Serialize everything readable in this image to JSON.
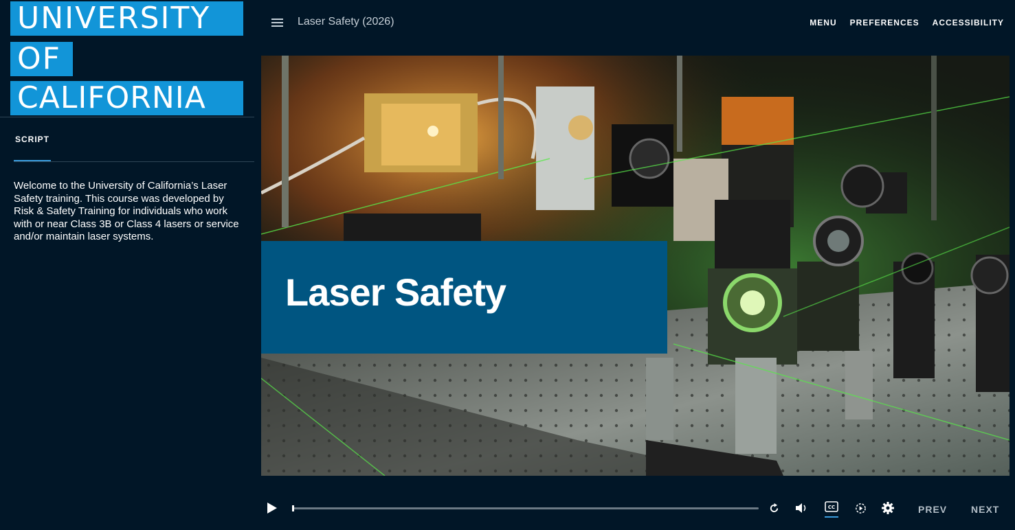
{
  "logo": {
    "lines": [
      "UNIVERSITY",
      "OF",
      "CALIFORNIA"
    ],
    "color": "#1295d8"
  },
  "sidebar": {
    "tab_label": "SCRIPT",
    "script_text": "Welcome to the University of California’s Laser Safety training. This course was developed by Risk & Safety Training for individuals who work with or near Class 3B or Class 4 lasers or service and/or maintain laser systems."
  },
  "topbar": {
    "course_title": "Laser Safety (2026)",
    "nav": [
      "MENU",
      "PREFERENCES",
      "ACCESSIBILITY"
    ]
  },
  "slide": {
    "title": "Laser Safety",
    "banner_color": "#005581"
  },
  "player": {
    "progress_fraction": 0.0,
    "icons": [
      "play-icon",
      "replay-icon",
      "volume-icon",
      "closed-captions-icon",
      "playback-speed-icon",
      "settings-icon"
    ],
    "prev_label": "PREV",
    "next_label": "NEXT"
  },
  "colors": {
    "background": "#011627",
    "accent": "#3a9bdc"
  }
}
